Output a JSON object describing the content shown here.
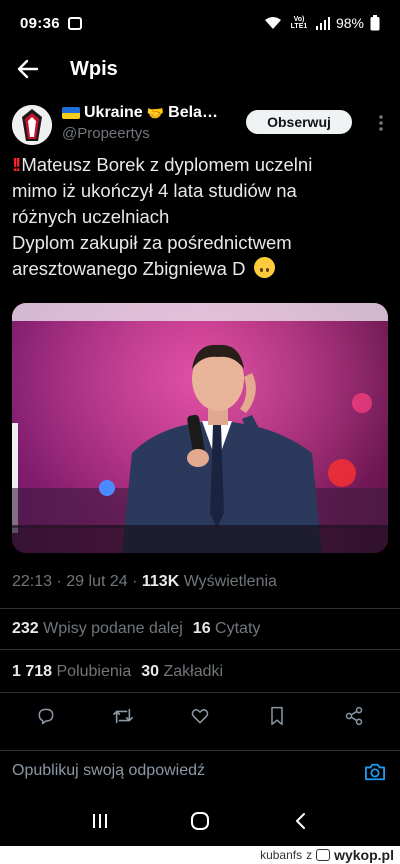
{
  "status_bar": {
    "time": "09:36",
    "network_label": "Vo) LTE1",
    "battery": "98%"
  },
  "header": {
    "title": "Wpis"
  },
  "author": {
    "display_name": "Ukraine",
    "display_name_cont": "Bela…",
    "handle": "@Propeertys",
    "follow_label": "Obserwuj"
  },
  "tweet": {
    "line1": "Mateusz Borek z dyplomem uczelni",
    "line2": "mimo iż ukończył 4 lata studiów na",
    "line3": "różnych uczelniach",
    "line4": "Dyplom zakupił za pośrednictwem",
    "line5": "aresztowanego Zbigniewa D"
  },
  "meta": {
    "time": "22:13",
    "date": "29 lut 24",
    "views_count": "113K",
    "views_label": "Wyświetlenia"
  },
  "stats": {
    "reposts_count": "232",
    "reposts_label": "Wpisy podane dalej",
    "quotes_count": "16",
    "quotes_label": "Cytaty",
    "likes_count": "1 718",
    "likes_label": "Polubienia",
    "bookmarks_count": "30",
    "bookmarks_label": "Zakładki"
  },
  "reply": {
    "placeholder": "Opublikuj swoją odpowiedź"
  },
  "watermark": {
    "user": "kubanfs",
    "conj": "z",
    "brand": "wykop.pl"
  },
  "icons": [
    "back-arrow-icon",
    "more-icon",
    "reply-icon",
    "repost-icon",
    "like-icon",
    "bookmark-icon",
    "share-icon",
    "camera-icon"
  ],
  "colors": {
    "accent": "#1d9bf0",
    "muted": "#71767b",
    "background": "#000000"
  }
}
